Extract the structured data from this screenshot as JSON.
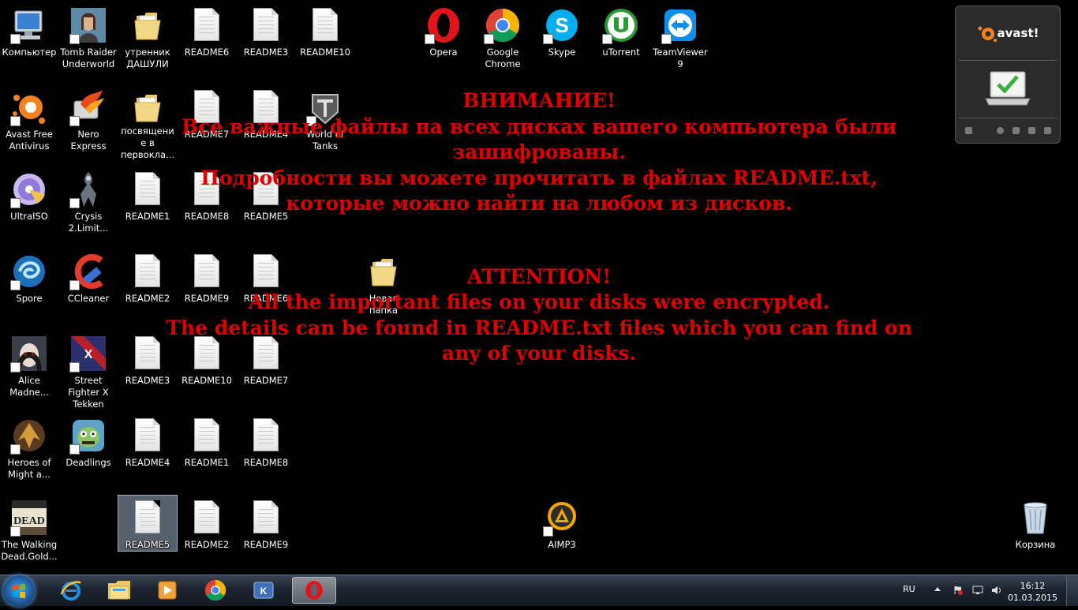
{
  "desktop": {
    "icons": {
      "computer": "Компьютер",
      "tomb_raider": "Tomb Raider Underworld",
      "utrennik": "утренник ДАШУЛИ",
      "readme6_top": "README6",
      "readme3_top": "README3",
      "readme10_top": "README10",
      "opera": "Opera",
      "chrome": "Google Chrome",
      "skype": "Skype",
      "utorrent": "uTorrent",
      "teamviewer": "TeamViewer 9",
      "avast_free": "Avast Free Antivirus",
      "nero": "Nero Express",
      "posvyashchenie": "посвящение в первокла...",
      "readme7_a": "README7",
      "readme4_a": "README4",
      "wot": "World of Tanks",
      "ultraiso": "UltraISO",
      "crysis": "Crysis 2.Limit...",
      "readme1_a": "README1",
      "readme8_a": "README8",
      "readme5_a": "README5",
      "spore": "Spore",
      "ccleaner": "CCleaner",
      "readme2_a": "README2",
      "readme9_a": "README9",
      "readme6_b": "README6",
      "new_folder": "Новая папка",
      "alice": "Alice Madne...",
      "sf_tekken": "Street Fighter X Tekken",
      "readme3_b": "README3",
      "readme10_b": "README10",
      "readme7_b": "README7",
      "heroes": "Heroes of Might a...",
      "deadlings": "Deadlings",
      "readme4_b": "README4",
      "readme1_b": "README1",
      "readme8_b": "README8",
      "walking_dead": "The Walking Dead.Gold...",
      "readme5_b": "README5",
      "readme2_b": "README2",
      "readme9_b": "README9",
      "aimp": "AIMP3",
      "recycle": "Корзина"
    },
    "ransom_note": {
      "ru_title": "ВНИМАНИЕ!",
      "ru_line1": "Все важные файлы на всех дисках вашего компьютера были",
      "ru_line2": "зашифрованы.",
      "ru_line3": "Подробности вы можете прочитать в файлах README.txt,",
      "ru_line4": "которые можно найти на любом из дисков.",
      "en_title": "ATTENTION!",
      "en_line1": "All the important files on your disks were encrypted.",
      "en_line2": "The details can be found in README.txt files which you can find on",
      "en_line3": "any of your disks."
    },
    "avast_gadget": {
      "logo": "avast!"
    }
  },
  "taskbar": {
    "language": "RU",
    "time": "16:12",
    "date": "01.03.2015"
  },
  "colors": {
    "ransom_text": "#e00000",
    "desktop_bg": "#000000",
    "avast_orange": "#f58220"
  }
}
